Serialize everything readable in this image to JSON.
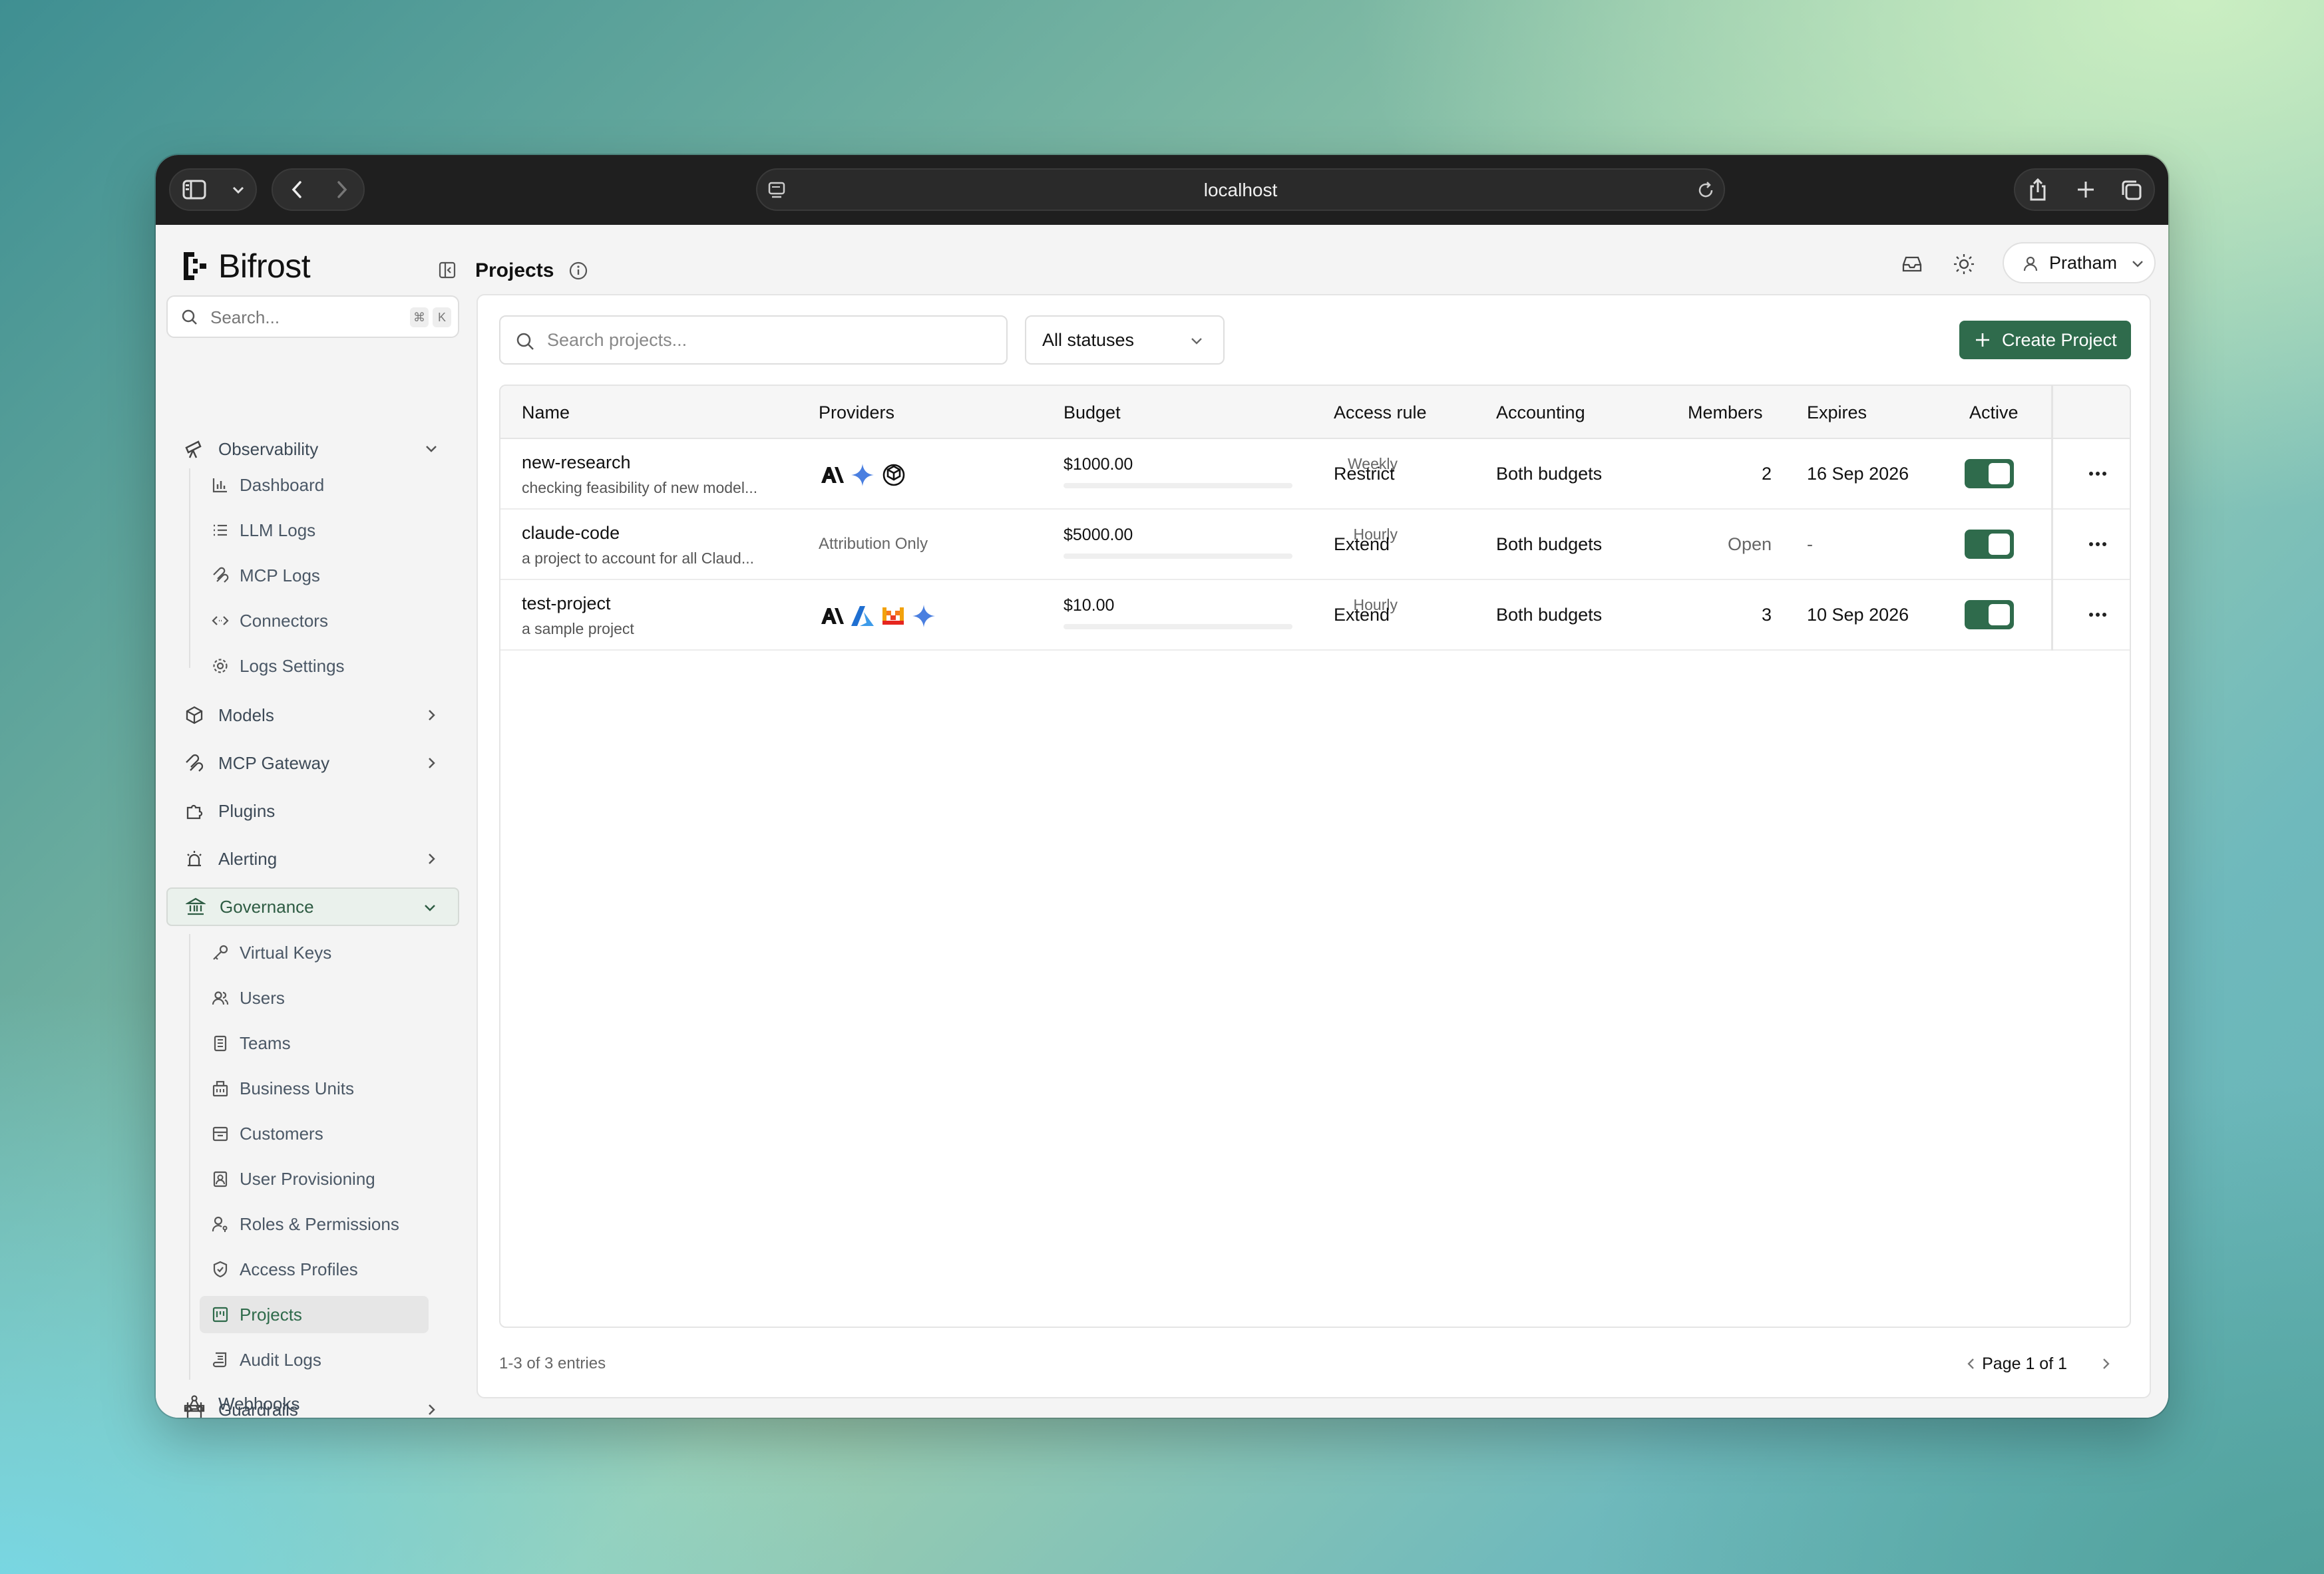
{
  "browser": {
    "url": "localhost"
  },
  "app": {
    "brand": "Bifrost"
  },
  "sidebar": {
    "search_placeholder": "Search...",
    "shortcut": [
      "⌘",
      "K"
    ],
    "observability": {
      "label": "Observability",
      "items": [
        "Dashboard",
        "LLM Logs",
        "MCP Logs",
        "Connectors",
        "Logs Settings"
      ]
    },
    "models": "Models",
    "mcp_gateway": "MCP Gateway",
    "plugins": "Plugins",
    "alerting": "Alerting",
    "governance": {
      "label": "Governance",
      "items": [
        "Virtual Keys",
        "Users",
        "Teams",
        "Business Units",
        "Customers",
        "User Provisioning",
        "Roles & Permissions",
        "Access Profiles",
        "Projects",
        "Audit Logs"
      ],
      "active": "Projects"
    },
    "guardrails": "Guardrails",
    "webhooks": "Webhooks"
  },
  "header": {
    "title": "Projects",
    "user": "Pratham"
  },
  "toolbar": {
    "search_placeholder": "Search projects...",
    "status_filter": "All statuses",
    "create_label": "Create Project"
  },
  "table": {
    "columns": [
      "Name",
      "Providers",
      "Budget",
      "Access rule",
      "Accounting",
      "Members",
      "Expires",
      "Active"
    ],
    "rows": [
      {
        "name": "new-research",
        "description": "checking feasibility of new model...",
        "providers": [
          "anthropic-icon",
          "gemini-icon",
          "openai-icon"
        ],
        "budget": "$1000.00",
        "period": "Weekly",
        "access_rule": "Restrict",
        "accounting": "Both budgets",
        "members": "2",
        "expires": "16 Sep 2026",
        "active": true
      },
      {
        "name": "claude-code",
        "description": "a project to account for all Claud...",
        "providers_text": "Attribution Only",
        "budget": "$5000.00",
        "period": "Hourly",
        "access_rule": "Extend",
        "accounting": "Both budgets",
        "members": "Open",
        "expires": "-",
        "active": true
      },
      {
        "name": "test-project",
        "description": "a sample project",
        "providers": [
          "anthropic-icon",
          "azure-icon",
          "mistral-icon",
          "gemini-icon"
        ],
        "budget": "$10.00",
        "period": "Hourly",
        "access_rule": "Extend",
        "accounting": "Both budgets",
        "members": "3",
        "expires": "10 Sep 2026",
        "active": true
      }
    ]
  },
  "footer": {
    "count": "1-3 of 3 entries",
    "page": "Page 1 of 1"
  },
  "colors": {
    "accent": "#2f6b4c",
    "chrome": "#1f1f1f"
  }
}
